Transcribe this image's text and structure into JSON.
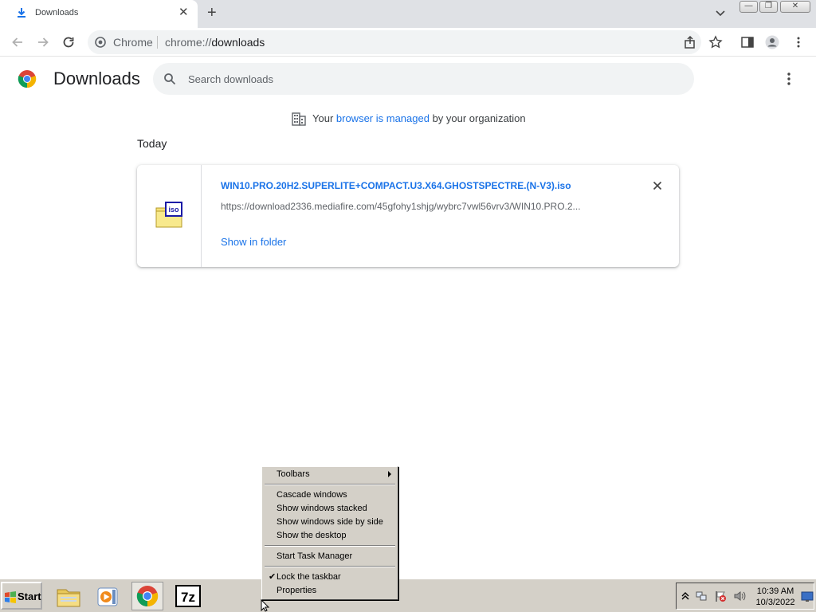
{
  "window": {
    "tab_title": "Downloads",
    "tab_close": "✕",
    "new_tab": "+",
    "minimize": "—",
    "restore": "❐",
    "close": "✕"
  },
  "toolbar": {
    "site_chip": "Chrome",
    "url_scheme": "chrome://",
    "url_host": "downloads"
  },
  "page": {
    "title": "Downloads",
    "search_placeholder": "Search downloads",
    "managed_before": "Your ",
    "managed_link": "browser is managed",
    "managed_after": " by your organization",
    "section_date": "Today"
  },
  "download": {
    "icon_label": "iso",
    "file_name": "WIN10.PRO.20H2.SUPERLITE+COMPACT.U3.X64.GHOSTSPECTRE.(N-V3).iso",
    "url": "https://download2336.mediafire.com/45gfohy1shjg/wybrc7vwl56vrv3/WIN10.PRO.2...",
    "show_in_folder": "Show in folder"
  },
  "taskbar": {
    "start_label": "Start",
    "clock_time": "10:39 AM",
    "clock_date": "10/3/2022"
  },
  "context_menu": {
    "toolbars": "Toolbars",
    "cascade": "Cascade windows",
    "stacked": "Show windows stacked",
    "side_by_side": "Show windows side by side",
    "show_desktop": "Show the desktop",
    "task_manager": "Start Task Manager",
    "lock_taskbar": "Lock the taskbar",
    "properties": "Properties",
    "check_mark": "✔"
  },
  "colors": {
    "accent": "#1a73e8",
    "tabstrip": "#dfe1e5",
    "taskbar": "#d4d0c8"
  }
}
